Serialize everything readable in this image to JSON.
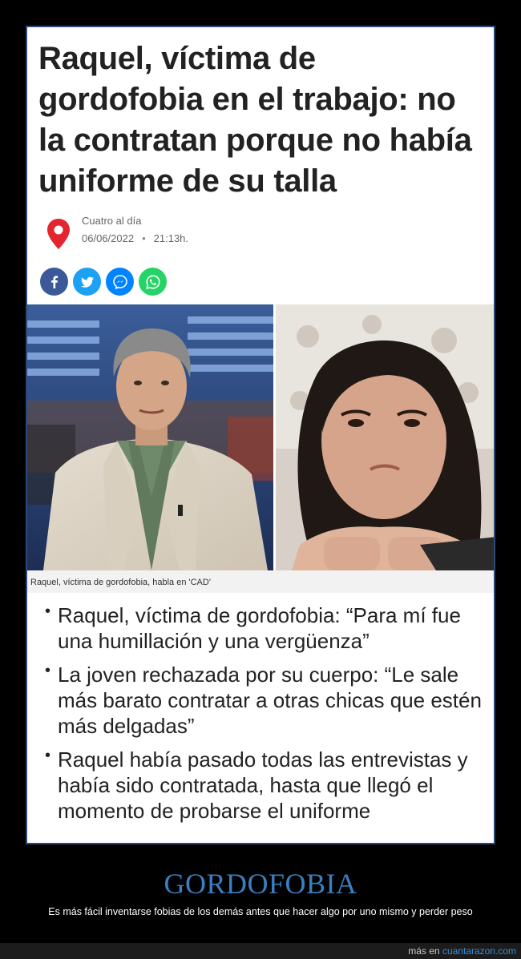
{
  "article": {
    "headline": "Raquel, víctima de gordofobia en el trabajo: no la contratan porque no había uniforme de su talla",
    "source_name": "Cuatro al día",
    "date": "06/06/2022",
    "separator": "•",
    "time": "21:13h.",
    "share_icons": [
      "facebook-icon",
      "twitter-icon",
      "messenger-icon",
      "whatsapp-icon"
    ],
    "caption": "Raquel, víctima de gordofobia, habla en 'CAD'",
    "bullet_mark": "•",
    "bullets": [
      "Raquel, víctima de gordofobia: “Para mí fue una humillación y una vergüenza”",
      "La joven rechazada por su cuerpo: “Le sale más barato contratar a otras chicas que estén más delgadas”",
      "Raquel había pasado todas las entrevistas y había sido contratada, hasta que llegó el momento de probarse el uniforme"
    ]
  },
  "post": {
    "title": "GORDOFOBIA",
    "description": "Es más fácil inventarse fobias de los demás antes que hacer algo por uno mismo y perder peso"
  },
  "footer": {
    "prefix": "más en",
    "link_text": "cuantarazon.com"
  },
  "colors": {
    "title_blue": "#3a7fc1",
    "pin_red": "#e3262e",
    "facebook": "#3b5998",
    "twitter": "#1da1f2",
    "messenger": "#0084ff",
    "whatsapp": "#25d366"
  }
}
